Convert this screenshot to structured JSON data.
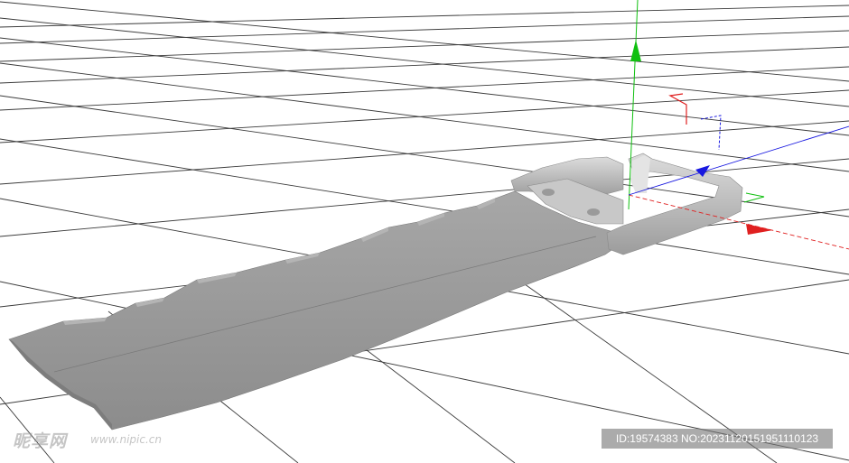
{
  "viewport": {
    "background": "#ffffff",
    "grid_color": "#3a3a3a",
    "model_color": "#9a9a9a",
    "axis_colors": {
      "x": "#e02020",
      "y": "#10c010",
      "z": "#1818e0"
    },
    "model_name": "saw-blade-with-buckle-handle"
  },
  "watermark": {
    "logo_text": "昵享网",
    "url_text": "www.nipic.cn"
  },
  "id_badge": {
    "text": "ID:19574383 NO:20231120151951110123"
  }
}
